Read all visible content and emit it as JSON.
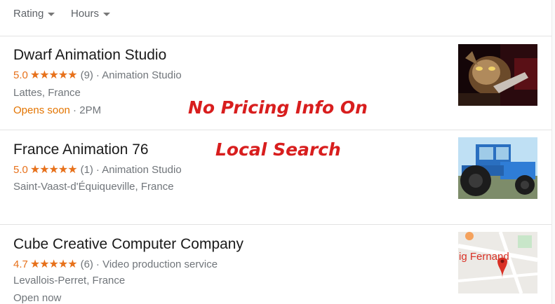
{
  "filters": [
    {
      "label": "Rating"
    },
    {
      "label": "Hours"
    }
  ],
  "listings": [
    {
      "name": "Dwarf Animation Studio",
      "rating": "5.0",
      "stars": "★★★★★",
      "reviews": "(9)",
      "category": "· Animation Studio",
      "location": "Lattes, France",
      "hours_status": "Opens soon",
      "hours_detail": " · 2PM"
    },
    {
      "name": "France Animation 76",
      "rating": "5.0",
      "stars": "★★★★★",
      "reviews": "(1)",
      "category": "· Animation Studio",
      "location": "Saint-Vaast-d'Équiqueville, France"
    },
    {
      "name": "Cube Creative Computer Company",
      "rating": "4.7",
      "stars": "★★★★★",
      "reviews": "(6)",
      "category": "· Video production service",
      "location": "Levallois-Perret, France",
      "hours_status": "Open now",
      "map_label": "ig Fernand"
    }
  ],
  "overlay": {
    "line1": "No Pricing Info On",
    "line2": "Local Search"
  },
  "colors": {
    "star": "#e7711b",
    "overlay_text": "#d81e1e",
    "opens_soon": "#e37400"
  }
}
